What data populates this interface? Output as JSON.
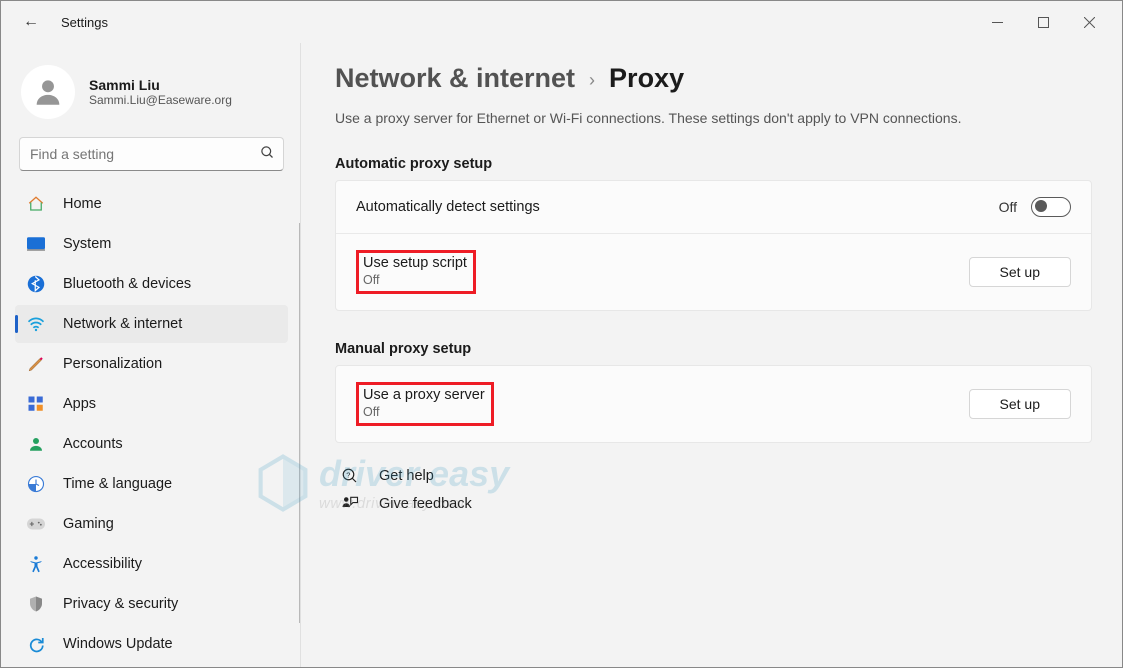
{
  "window": {
    "title": "Settings"
  },
  "user": {
    "name": "Sammi Liu",
    "email": "Sammi.Liu@Easeware.org"
  },
  "search": {
    "placeholder": "Find a setting"
  },
  "nav": [
    {
      "label": "Home",
      "key": "home"
    },
    {
      "label": "System",
      "key": "system"
    },
    {
      "label": "Bluetooth & devices",
      "key": "bluetooth"
    },
    {
      "label": "Network & internet",
      "key": "network",
      "active": true
    },
    {
      "label": "Personalization",
      "key": "personalization"
    },
    {
      "label": "Apps",
      "key": "apps"
    },
    {
      "label": "Accounts",
      "key": "accounts"
    },
    {
      "label": "Time & language",
      "key": "time"
    },
    {
      "label": "Gaming",
      "key": "gaming"
    },
    {
      "label": "Accessibility",
      "key": "accessibility"
    },
    {
      "label": "Privacy & security",
      "key": "privacy"
    },
    {
      "label": "Windows Update",
      "key": "update"
    }
  ],
  "breadcrumb": {
    "parent": "Network & internet",
    "current": "Proxy"
  },
  "description": "Use a proxy server for Ethernet or Wi-Fi connections. These settings don't apply to VPN connections.",
  "sections": {
    "auto": {
      "title": "Automatic proxy setup",
      "detect": {
        "label": "Automatically detect settings",
        "state": "Off"
      },
      "script": {
        "label": "Use setup script",
        "state": "Off",
        "button": "Set up"
      }
    },
    "manual": {
      "title": "Manual proxy setup",
      "proxy": {
        "label": "Use a proxy server",
        "state": "Off",
        "button": "Set up"
      }
    }
  },
  "help": {
    "gethelp": "Get help",
    "feedback": "Give feedback"
  },
  "watermark": {
    "brand": "driver easy",
    "url": "www.drivereasy.com"
  }
}
